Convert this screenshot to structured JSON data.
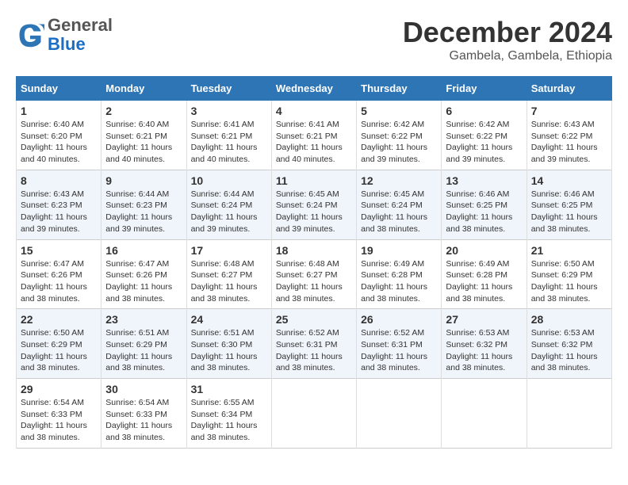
{
  "logo": {
    "general": "General",
    "blue": "Blue"
  },
  "title": "December 2024",
  "subtitle": "Gambela, Gambela, Ethiopia",
  "days_of_week": [
    "Sunday",
    "Monday",
    "Tuesday",
    "Wednesday",
    "Thursday",
    "Friday",
    "Saturday"
  ],
  "weeks": [
    [
      {
        "day": 1,
        "sunrise": "6:40 AM",
        "sunset": "6:20 PM",
        "daylight": "11 hours and 40 minutes."
      },
      {
        "day": 2,
        "sunrise": "6:40 AM",
        "sunset": "6:21 PM",
        "daylight": "11 hours and 40 minutes."
      },
      {
        "day": 3,
        "sunrise": "6:41 AM",
        "sunset": "6:21 PM",
        "daylight": "11 hours and 40 minutes."
      },
      {
        "day": 4,
        "sunrise": "6:41 AM",
        "sunset": "6:21 PM",
        "daylight": "11 hours and 40 minutes."
      },
      {
        "day": 5,
        "sunrise": "6:42 AM",
        "sunset": "6:22 PM",
        "daylight": "11 hours and 39 minutes."
      },
      {
        "day": 6,
        "sunrise": "6:42 AM",
        "sunset": "6:22 PM",
        "daylight": "11 hours and 39 minutes."
      },
      {
        "day": 7,
        "sunrise": "6:43 AM",
        "sunset": "6:22 PM",
        "daylight": "11 hours and 39 minutes."
      }
    ],
    [
      {
        "day": 8,
        "sunrise": "6:43 AM",
        "sunset": "6:23 PM",
        "daylight": "11 hours and 39 minutes."
      },
      {
        "day": 9,
        "sunrise": "6:44 AM",
        "sunset": "6:23 PM",
        "daylight": "11 hours and 39 minutes."
      },
      {
        "day": 10,
        "sunrise": "6:44 AM",
        "sunset": "6:24 PM",
        "daylight": "11 hours and 39 minutes."
      },
      {
        "day": 11,
        "sunrise": "6:45 AM",
        "sunset": "6:24 PM",
        "daylight": "11 hours and 39 minutes."
      },
      {
        "day": 12,
        "sunrise": "6:45 AM",
        "sunset": "6:24 PM",
        "daylight": "11 hours and 38 minutes."
      },
      {
        "day": 13,
        "sunrise": "6:46 AM",
        "sunset": "6:25 PM",
        "daylight": "11 hours and 38 minutes."
      },
      {
        "day": 14,
        "sunrise": "6:46 AM",
        "sunset": "6:25 PM",
        "daylight": "11 hours and 38 minutes."
      }
    ],
    [
      {
        "day": 15,
        "sunrise": "6:47 AM",
        "sunset": "6:26 PM",
        "daylight": "11 hours and 38 minutes."
      },
      {
        "day": 16,
        "sunrise": "6:47 AM",
        "sunset": "6:26 PM",
        "daylight": "11 hours and 38 minutes."
      },
      {
        "day": 17,
        "sunrise": "6:48 AM",
        "sunset": "6:27 PM",
        "daylight": "11 hours and 38 minutes."
      },
      {
        "day": 18,
        "sunrise": "6:48 AM",
        "sunset": "6:27 PM",
        "daylight": "11 hours and 38 minutes."
      },
      {
        "day": 19,
        "sunrise": "6:49 AM",
        "sunset": "6:28 PM",
        "daylight": "11 hours and 38 minutes."
      },
      {
        "day": 20,
        "sunrise": "6:49 AM",
        "sunset": "6:28 PM",
        "daylight": "11 hours and 38 minutes."
      },
      {
        "day": 21,
        "sunrise": "6:50 AM",
        "sunset": "6:29 PM",
        "daylight": "11 hours and 38 minutes."
      }
    ],
    [
      {
        "day": 22,
        "sunrise": "6:50 AM",
        "sunset": "6:29 PM",
        "daylight": "11 hours and 38 minutes."
      },
      {
        "day": 23,
        "sunrise": "6:51 AM",
        "sunset": "6:29 PM",
        "daylight": "11 hours and 38 minutes."
      },
      {
        "day": 24,
        "sunrise": "6:51 AM",
        "sunset": "6:30 PM",
        "daylight": "11 hours and 38 minutes."
      },
      {
        "day": 25,
        "sunrise": "6:52 AM",
        "sunset": "6:31 PM",
        "daylight": "11 hours and 38 minutes."
      },
      {
        "day": 26,
        "sunrise": "6:52 AM",
        "sunset": "6:31 PM",
        "daylight": "11 hours and 38 minutes."
      },
      {
        "day": 27,
        "sunrise": "6:53 AM",
        "sunset": "6:32 PM",
        "daylight": "11 hours and 38 minutes."
      },
      {
        "day": 28,
        "sunrise": "6:53 AM",
        "sunset": "6:32 PM",
        "daylight": "11 hours and 38 minutes."
      }
    ],
    [
      {
        "day": 29,
        "sunrise": "6:54 AM",
        "sunset": "6:33 PM",
        "daylight": "11 hours and 38 minutes."
      },
      {
        "day": 30,
        "sunrise": "6:54 AM",
        "sunset": "6:33 PM",
        "daylight": "11 hours and 38 minutes."
      },
      {
        "day": 31,
        "sunrise": "6:55 AM",
        "sunset": "6:34 PM",
        "daylight": "11 hours and 38 minutes."
      },
      null,
      null,
      null,
      null
    ]
  ]
}
